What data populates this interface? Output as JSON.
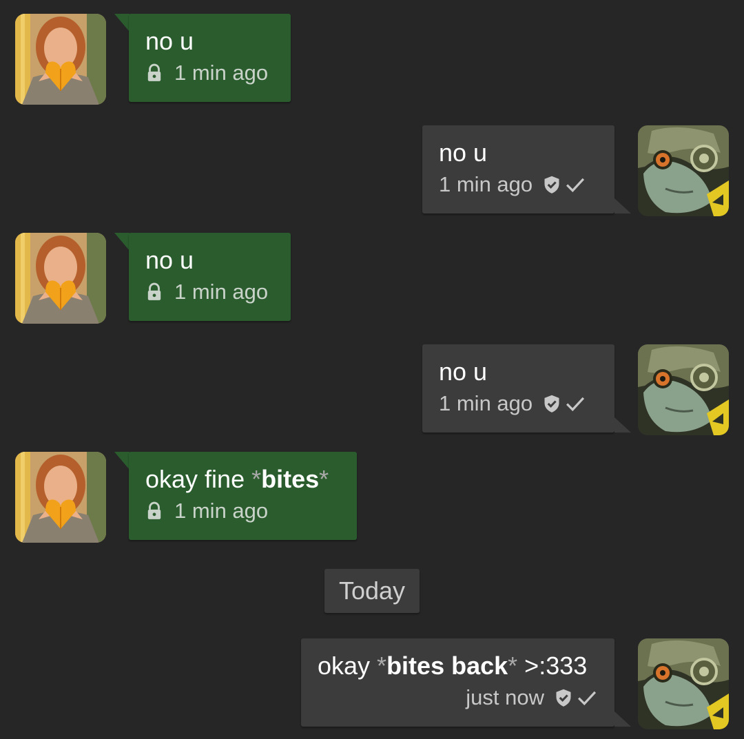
{
  "chat": {
    "messages": [
      {
        "direction": "incoming",
        "text": "no u",
        "time": "1 min ago",
        "status_icon": "lock-icon"
      },
      {
        "direction": "outgoing",
        "text": "no u",
        "time": "1 min ago",
        "status_icons": [
          "shield-check-icon",
          "checkmark-icon"
        ]
      },
      {
        "direction": "incoming",
        "text": "no u",
        "time": "1 min ago",
        "status_icon": "lock-icon"
      },
      {
        "direction": "outgoing",
        "text": "no u",
        "time": "1 min ago",
        "status_icons": [
          "shield-check-icon",
          "checkmark-icon"
        ]
      },
      {
        "direction": "incoming",
        "text_parts": [
          "okay fine ",
          "*",
          "bites",
          "*"
        ],
        "time": "1 min ago",
        "status_icon": "lock-icon"
      },
      {
        "direction": "outgoing",
        "text_parts": [
          "okay ",
          "*",
          "bites back",
          "*",
          " >:333"
        ],
        "time": "just now",
        "status_icons": [
          "shield-check-icon",
          "checkmark-icon"
        ]
      }
    ],
    "date_separator": "Today"
  },
  "colors": {
    "background": "#262626",
    "incoming_bubble": "#2a5c2e",
    "outgoing_bubble": "#3c3c3c",
    "text": "#ffffff",
    "asterisk": "#a9a9a9"
  }
}
